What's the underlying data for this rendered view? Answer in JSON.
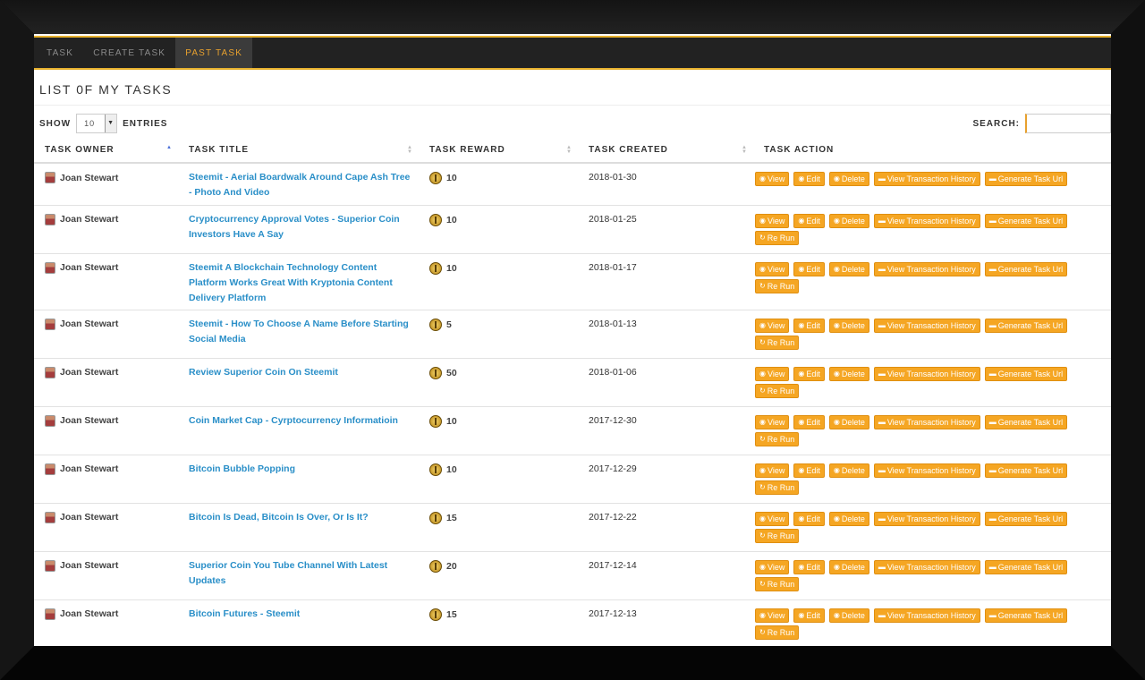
{
  "nav": {
    "items": [
      {
        "label": "TASK",
        "active": false
      },
      {
        "label": "CREATE TASK",
        "active": false
      },
      {
        "label": "PAST TASK",
        "active": true
      }
    ]
  },
  "page_title": "LIST 0F MY TASKS",
  "controls": {
    "show_label": "SHOW",
    "entries_value": "10",
    "entries_label": "ENTRIES",
    "search_label": "SEARCH:",
    "search_value": ""
  },
  "table": {
    "headers": [
      "TASK OWNER",
      "TASK TITLE",
      "TASK REWARD",
      "TASK CREATED",
      "TASK ACTION"
    ],
    "action_labels": {
      "view": "View",
      "edit": "Edit",
      "delete": "Delete",
      "history": "View Transaction History",
      "generate": "Generate Task Url",
      "rerun": "Re Run"
    },
    "rows": [
      {
        "owner": "Joan Stewart",
        "title": "Steemit - Aerial Boardwalk Around Cape Ash Tree - Photo And Video",
        "reward": "10",
        "created": "2018-01-30",
        "rerun": false
      },
      {
        "owner": "Joan Stewart",
        "title": "Cryptocurrency Approval Votes - Superior Coin Investors Have A Say",
        "reward": "10",
        "created": "2018-01-25",
        "rerun": true
      },
      {
        "owner": "Joan Stewart",
        "title": "Steemit A Blockchain Technology Content Platform Works Great With Kryptonia Content Delivery Platform",
        "reward": "10",
        "created": "2018-01-17",
        "rerun": true
      },
      {
        "owner": "Joan Stewart",
        "title": "Steemit - How To Choose A Name Before Starting Social Media",
        "reward": "5",
        "created": "2018-01-13",
        "rerun": true
      },
      {
        "owner": "Joan Stewart",
        "title": "Review Superior Coin On Steemit",
        "reward": "50",
        "created": "2018-01-06",
        "rerun": true
      },
      {
        "owner": "Joan Stewart",
        "title": "Coin Market Cap - Cyrptocurrency Informatioin",
        "reward": "10",
        "created": "2017-12-30",
        "rerun": true
      },
      {
        "owner": "Joan Stewart",
        "title": "Bitcoin Bubble Popping",
        "reward": "10",
        "created": "2017-12-29",
        "rerun": true
      },
      {
        "owner": "Joan Stewart",
        "title": "Bitcoin Is Dead, Bitcoin Is Over, Or Is It?",
        "reward": "15",
        "created": "2017-12-22",
        "rerun": true
      },
      {
        "owner": "Joan Stewart",
        "title": "Superior Coin You Tube Channel With Latest Updates",
        "reward": "20",
        "created": "2017-12-14",
        "rerun": true
      },
      {
        "owner": "Joan Stewart",
        "title": "Bitcoin Futures - Steemit",
        "reward": "15",
        "created": "2017-12-13",
        "rerun": true
      }
    ]
  },
  "colors": {
    "accent": "#e8b22e",
    "button": "#f5a623",
    "link": "#2a8fc8",
    "nav_bg": "#222222"
  }
}
